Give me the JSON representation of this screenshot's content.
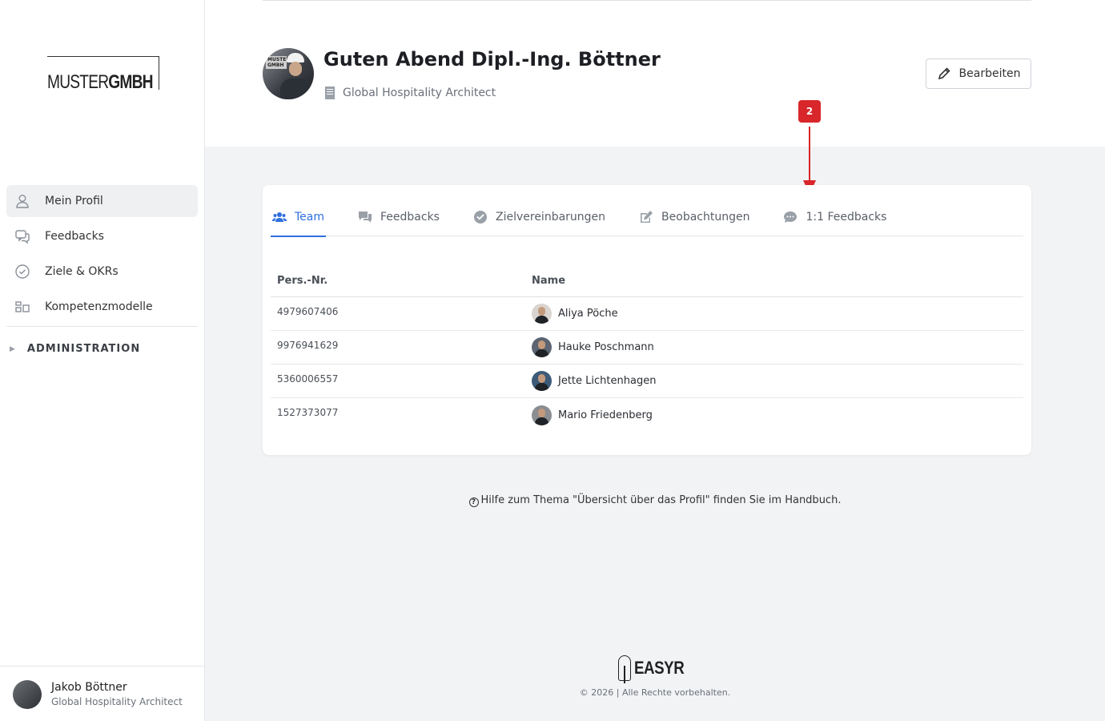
{
  "brand": {
    "logo_light": "MUSTER",
    "logo_bold": "GMBH"
  },
  "sidebar": {
    "items": [
      {
        "label": "Mein Profil",
        "icon": "user-icon",
        "active": true
      },
      {
        "label": "Feedbacks",
        "icon": "chat-bubbles-icon",
        "active": false
      },
      {
        "label": "Ziele & OKRs",
        "icon": "check-circle-icon",
        "active": false
      },
      {
        "label": "Kompetenzmodelle",
        "icon": "grid-icon",
        "active": false
      }
    ],
    "admin_label": "ADMINISTRATION",
    "user": {
      "name": "Jakob Böttner",
      "role": "Global Hospitality Architect"
    }
  },
  "header": {
    "greeting": "Guten Abend Dipl.-Ing. Böttner",
    "subtitle": "Global Hospitality Architect",
    "edit_label": "Bearbeiten",
    "avatar_sign": "MUSTER GMBH"
  },
  "annotation": {
    "badge": "2",
    "color": "#d8262b"
  },
  "tabs": [
    {
      "label": "Team",
      "icon": "users-icon",
      "active": true
    },
    {
      "label": "Feedbacks",
      "icon": "comments-icon",
      "active": false
    },
    {
      "label": "Zielvereinbarungen",
      "icon": "check-circle-icon",
      "active": false
    },
    {
      "label": "Beobachtungen",
      "icon": "edit-icon",
      "active": false
    },
    {
      "label": "1:1 Feedbacks",
      "icon": "speech-icon",
      "active": false
    }
  ],
  "table": {
    "headers": [
      "Pers.-Nr.",
      "Name"
    ],
    "rows": [
      {
        "nr": "4979607406",
        "name": "Aliya Pöche"
      },
      {
        "nr": "9976941629",
        "name": "Hauke Poschmann"
      },
      {
        "nr": "5360006557",
        "name": "Jette Lichtenhagen"
      },
      {
        "nr": "1527373077",
        "name": "Mario Friedenberg"
      }
    ]
  },
  "help_text": "Hilfe zum Thema \"Übersicht über das Profil\" finden Sie im Handbuch.",
  "footer": {
    "logo": "EASYR",
    "copyright": "© 2026 | Alle Rechte vorbehalten."
  },
  "colors": {
    "accent": "#2f6fde",
    "annotation": "#d8262b"
  }
}
